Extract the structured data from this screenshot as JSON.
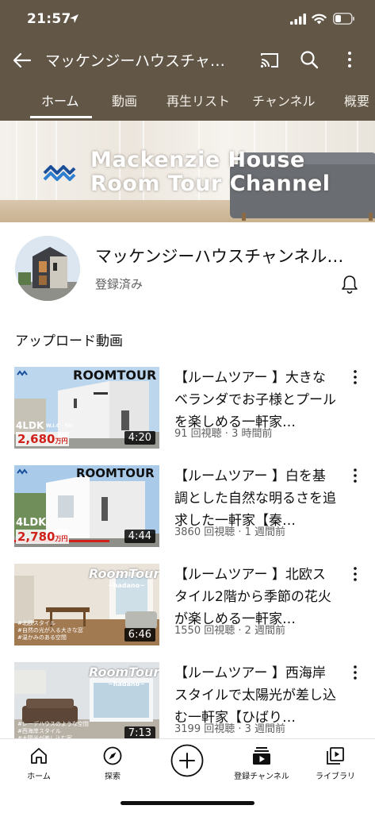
{
  "status": {
    "time": "21:57"
  },
  "appbar": {
    "title": "マッケンジーハウスチャ…"
  },
  "tabs": [
    {
      "label": "ホーム"
    },
    {
      "label": "動画"
    },
    {
      "label": "再生リスト"
    },
    {
      "label": "チャンネル"
    },
    {
      "label": "概要"
    }
  ],
  "banner": {
    "line1": "Mackenzie House",
    "line2": "Room Tour Channel"
  },
  "channel": {
    "name": "マッケンジーハウスチャンネル…",
    "subscribed": "登録済み"
  },
  "section": {
    "title": "アップロード動画"
  },
  "videos": [
    {
      "title": "【ルームツアー 】大きなベランダでお子様とプールを楽しめる一軒家…",
      "meta": "91 回視聴 · 3 時間前",
      "duration": "4:20",
      "thumb": {
        "badge": "ROOMTOUR",
        "layout": "4LDK",
        "extra": "W.I.C · SIC",
        "price": "2,680",
        "price_unit": "万円"
      }
    },
    {
      "title": "【ルームツアー 】白を基調とした自然な明るさを追求した一軒家【秦…",
      "meta": "3860 回視聴 · 1 週間前",
      "duration": "4:44",
      "thumb": {
        "badge": "ROOMTOUR",
        "layout": "4LDK",
        "price": "2,780",
        "price_unit": "万円"
      }
    },
    {
      "title": "【ルームツアー 】北欧スタイル2階から季節の花火が楽しめる一軒家…",
      "meta": "1550 回視聴 · 2 週間前",
      "duration": "6:46",
      "thumb": {
        "badge": "RoomTour",
        "sub": "~hadano~",
        "notes": [
          "#北欧スタイル",
          "#自然の光が入る大きな窓",
          "#温かみのある空間"
        ]
      }
    },
    {
      "title": "【ルームツアー 】西海岸スタイルで太陽光が差し込む一軒家【ひばり…",
      "meta": "3199 回視聴 · 3 週間前",
      "duration": "7:13",
      "thumb": {
        "badge": "RoomTour",
        "sub": "~hadano~",
        "notes": [
          "#レーデハウスのような空間",
          "#西海岸スタイル",
          "#太陽光が差し込む家"
        ]
      }
    }
  ],
  "bottomnav": [
    {
      "label": "ホーム",
      "icon": "home-icon"
    },
    {
      "label": "探索",
      "icon": "compass-icon"
    },
    {
      "label": "",
      "icon": "add-icon"
    },
    {
      "label": "登録チャンネル",
      "icon": "subscriptions-icon"
    },
    {
      "label": "ライブラリ",
      "icon": "library-icon"
    }
  ],
  "colors": {
    "header_bg": "#625646",
    "price_red": "#d0201a"
  }
}
